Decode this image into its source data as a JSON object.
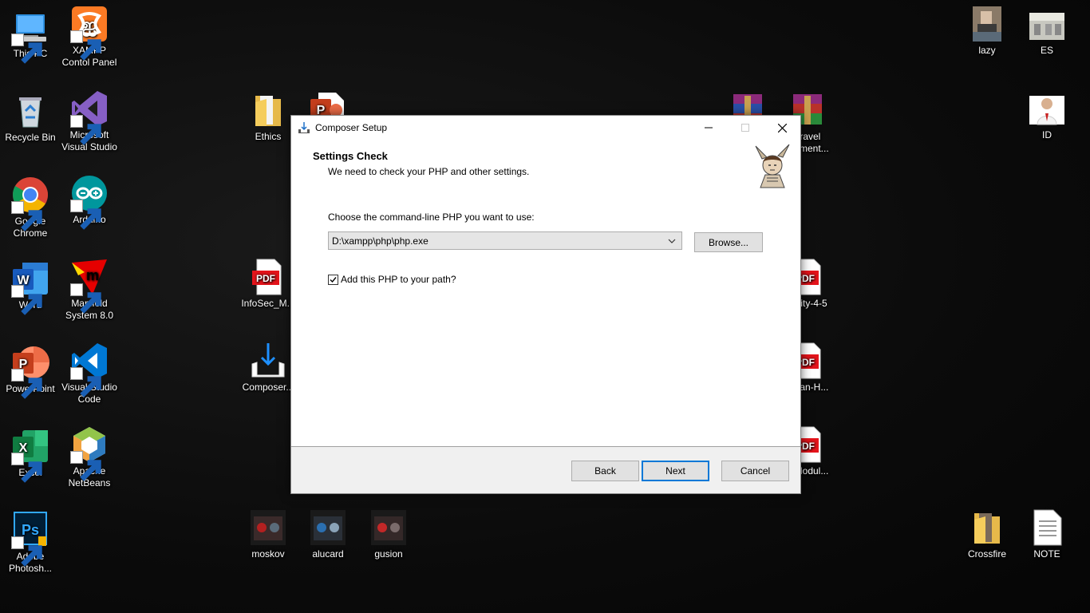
{
  "desktop": {
    "icons_left": [
      {
        "label": "This PC",
        "icon": "this-pc-icon"
      },
      {
        "label": "XAMPP Contol Panel",
        "icon": "xampp-icon"
      },
      {
        "label": "Recycle Bin",
        "icon": "recycle-bin-icon"
      },
      {
        "label": "Microsoft Visual Studio",
        "icon": "visual-studio-icon"
      },
      {
        "label": "Google Chrome",
        "icon": "chrome-icon"
      },
      {
        "label": "Arduino",
        "icon": "arduino-icon"
      },
      {
        "label": "Word",
        "icon": "word-icon"
      },
      {
        "label": "Manifold System 8.0",
        "icon": "manifold-icon"
      },
      {
        "label": "PowerPoint",
        "icon": "powerpoint-icon"
      },
      {
        "label": "Visual Studio Code",
        "icon": "vscode-icon"
      },
      {
        "label": "Excel",
        "icon": "excel-icon"
      },
      {
        "label": "Apache NetBeans",
        "icon": "netbeans-icon"
      },
      {
        "label": "Adobe Photosh...",
        "icon": "photoshop-icon"
      }
    ],
    "icons_middle": [
      {
        "label": "Ethics",
        "icon": "folder-icon"
      },
      {
        "label": "InfoSec_M...",
        "icon": "pdf-icon"
      },
      {
        "label": "Composer...",
        "icon": "installer-icon"
      },
      {
        "label": "moskov",
        "icon": "game-image-icon"
      },
      {
        "label": "alucard",
        "icon": "game-image-icon"
      },
      {
        "label": "gusion",
        "icon": "game-image-icon"
      }
    ],
    "icons_right": [
      {
        "label": "lazy",
        "icon": "photo-icon"
      },
      {
        "label": "ES",
        "icon": "photo-icon"
      },
      {
        "label": "ID",
        "icon": "photo-icon"
      },
      {
        "label": "aravel ...ament...",
        "icon": "winrar-icon"
      },
      {
        "label": "...vity-4-5",
        "icon": "pdf-icon"
      },
      {
        "label": "...rlan-H...",
        "icon": "pdf-icon"
      },
      {
        "label": "...Modul...",
        "icon": "pdf-icon"
      },
      {
        "label": "Crossfire",
        "icon": "folder-icon"
      },
      {
        "label": "NOTE",
        "icon": "text-file-icon"
      }
    ]
  },
  "dialog": {
    "title": "Composer Setup",
    "heading": "Settings Check",
    "subheading": "We need to check your PHP and other settings.",
    "choose_label": "Choose the command-line PHP you want to use:",
    "php_path": "D:\\xampp\\php\\php.exe",
    "browse_label": "Browse...",
    "add_path_label": "Add this PHP to your path?",
    "add_path_checked": true,
    "back_label": "Back",
    "next_label": "Next",
    "cancel_label": "Cancel",
    "accent_color": "#0078d7"
  }
}
